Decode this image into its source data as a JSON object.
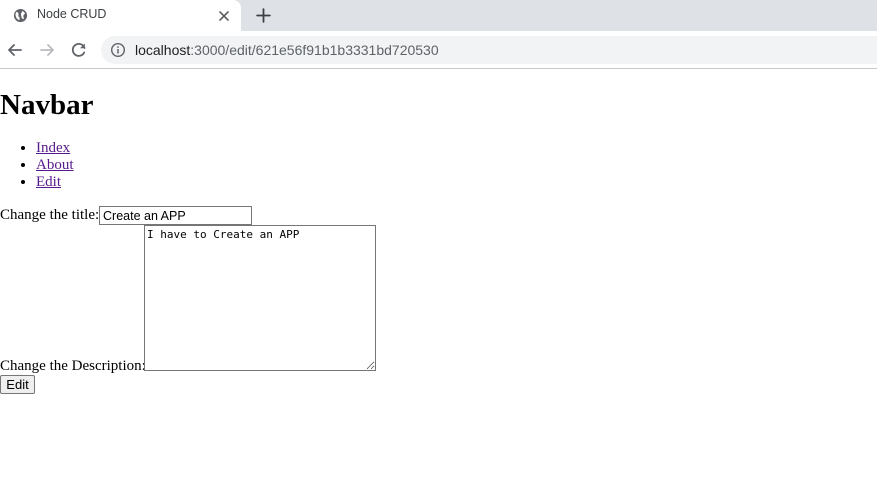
{
  "browser": {
    "tab_title": "Node CRUD",
    "url_host": "localhost",
    "url_path": ":3000/edit/621e56f91b1b3331bd720530",
    "icons": {
      "favicon": "globe-icon",
      "tab_close": "close-icon",
      "new_tab": "plus-icon",
      "back": "arrow-left-icon",
      "forward": "arrow-right-icon",
      "reload": "reload-icon",
      "site_info": "info-icon"
    }
  },
  "page": {
    "heading": "Navbar",
    "nav_links": [
      "Index",
      "About",
      "Edit"
    ],
    "form": {
      "title_label": "Change the title:",
      "title_value": "Create an APP",
      "description_label": "Change the Description:",
      "description_value": "I have to Create an APP",
      "submit_label": "Edit"
    }
  },
  "colors": {
    "tabstrip": "#dee1e6",
    "omnibox": "#f1f3f4",
    "visited_link": "#551a8b"
  }
}
